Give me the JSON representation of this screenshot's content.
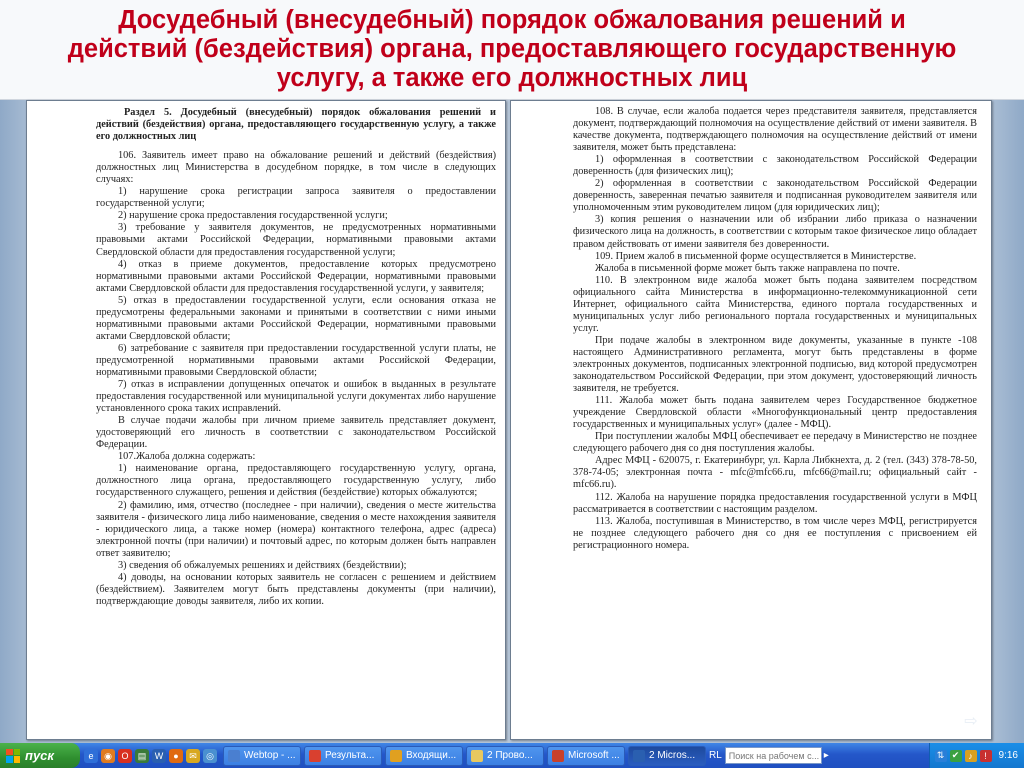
{
  "slide": {
    "title_lines": [
      "Досудебный (внесудебный) порядок обжалования решений и",
      "действий (бездействия) органа, предоставляющего государственную",
      "услугу, а также его должностных лиц"
    ]
  },
  "left_page": {
    "heading": "Раздел 5. Досудебный (внесудебный) порядок обжалования решений и действий (бездействия) органа, предоставляющего государственную услугу, а также его должностных лиц",
    "paragraphs": [
      "106. Заявитель имеет право на обжалование решений и действий (бездействия) должностных лиц Министерства в досудебном порядке, в том числе в следующих случаях:",
      "1) нарушение срока регистрации запроса заявителя о предоставлении государственной услуги;",
      "2) нарушение срока предоставления государственной услуги;",
      "3) требование у заявителя документов, не предусмотренных нормативными правовыми актами Российской Федерации, нормативными правовыми актами Свердловской области для предоставления государственной услуги;",
      "4) отказ в приеме документов, предоставление которых предусмотрено нормативными правовыми актами Российской Федерации, нормативными правовыми актами Свердловской области для предоставления государственной услуги, у заявителя;",
      "5) отказ в предоставлении государственной услуги, если основания отказа не предусмотрены федеральными законами и принятыми в соответствии с ними иными нормативными правовыми актами Российской Федерации, нормативными правовыми актами Свердловской области;",
      "6) затребование с заявителя при предоставлении государственной услуги платы, не предусмотренной нормативными правовыми актами Российской Федерации, нормативными правовыми Свердловской области;",
      "7) отказ в исправлении допущенных опечаток и ошибок в выданных в результате предоставления государственной или муниципальной услуги документах либо нарушение установленного срока таких исправлений.",
      "В случае подачи жалобы при личном приеме заявитель представляет документ, удостоверяющий его личность в соответствии с законодательством Российской Федерации.",
      "107.Жалоба должна содержать:",
      "1) наименование органа, предоставляющего государственную услугу, органа, должностного лица органа, предоставляющего государственную услугу, либо государственного служащего, решения и действия (бездействие) которых обжалуются;",
      "2) фамилию, имя, отчество (последнее - при наличии), сведения о месте жительства заявителя - физического лица либо наименование, сведения о месте нахождения заявителя - юридического лица, а также номер (номера) контактного телефона, адрес (адреса) электронной почты (при наличии) и почтовый адрес, по которым должен быть направлен ответ заявителю;",
      "3) сведения об обжалуемых решениях и действиях (бездействии);",
      "4) доводы, на основании которых заявитель не согласен с решением и действием (бездействием). Заявителем могут быть представлены документы (при наличии), подтверждающие доводы заявителя, либо их копии."
    ]
  },
  "right_page": {
    "paragraphs": [
      "108. В случае, если жалоба подается через представителя заявителя, представляется документ, подтверждающий полномочия на осуществление действий от имени заявителя. В качестве документа, подтверждающего полномочия на осуществление действий от имени заявителя, может быть представлена:",
      "1) оформленная в соответствии с законодательством Российской Федерации доверенность (для физических лиц);",
      "2) оформленная в соответствии с законодательством Российской Федерации доверенность, заверенная печатью заявителя и подписанная руководителем заявителя или уполномоченным этим руководителем лицом (для юридических лиц);",
      "3) копия решения о назначении или об избрании либо приказа о назначении физического лица на должность, в соответствии с которым такое физическое лицо обладает правом действовать от имени заявителя без доверенности.",
      "109. Прием жалоб в письменной форме осуществляется в Министерстве.",
      "Жалоба в письменной форме может быть также направлена по почте.",
      "110. В электронном виде жалоба может быть подана заявителем посредством официального сайта Министерства в информационно-телекоммуникационной сети Интернет, официального сайта Министерства, единого портала государственных и муниципальных услуг либо регионального портала государственных и муниципальных услуг.",
      "При подаче жалобы в электронном виде документы, указанные в пункте -108 настоящего Административного регламента, могут быть представлены в форме электронных документов, подписанных электронной подписью, вид которой предусмотрен законодательством Российской Федерации, при этом документ, удостоверяющий личность заявителя, не требуется.",
      "111. Жалоба может быть подана заявителем через Государственное бюджетное учреждение Свердловской области «Многофункциональный центр предоставления государственных и муниципальных услуг» (далее - МФЦ).",
      "При поступлении жалобы МФЦ обеспечивает ее передачу в Министерство не позднее следующего рабочего дня со дня поступления жалобы.",
      "Адрес МФЦ - 620075, г. Екатеринбург, ул. Карла Либкнехта, д. 2 (тел. (343) 378-78-50, 378-74-05; электронная почта - mfc@mfc66.ru, mfc66@mail.ru; официальный сайт - mfc66.ru).",
      "112. Жалоба на нарушение порядка предоставления государственной услуги в МФЦ рассматривается в соответствии с настоящим разделом.",
      "113. Жалоба, поступившая в Министерство, в том числе через МФЦ, регистрируется не позднее следующего рабочего дня со дня ее поступления с присвоением ей регистрационного номера."
    ]
  },
  "slide_nav": {
    "next_arrow": "⇨"
  },
  "taskbar": {
    "start_label": "пуск",
    "tasks": [
      {
        "label": "Webtop - ...",
        "color": "#4a7fd0"
      },
      {
        "label": "Результа...",
        "color": "#d9402f"
      },
      {
        "label": "Входящи...",
        "color": "#e0a020"
      },
      {
        "label": "2 Прово...",
        "color": "#e8c860"
      },
      {
        "label": "Microsoft ...",
        "color": "#c8402a"
      },
      {
        "label": "2 Micros...",
        "color": "#2a5fb0"
      }
    ],
    "lang": "RL",
    "search_placeholder": "Поиск на рабочем с...",
    "clock": "9:16"
  }
}
